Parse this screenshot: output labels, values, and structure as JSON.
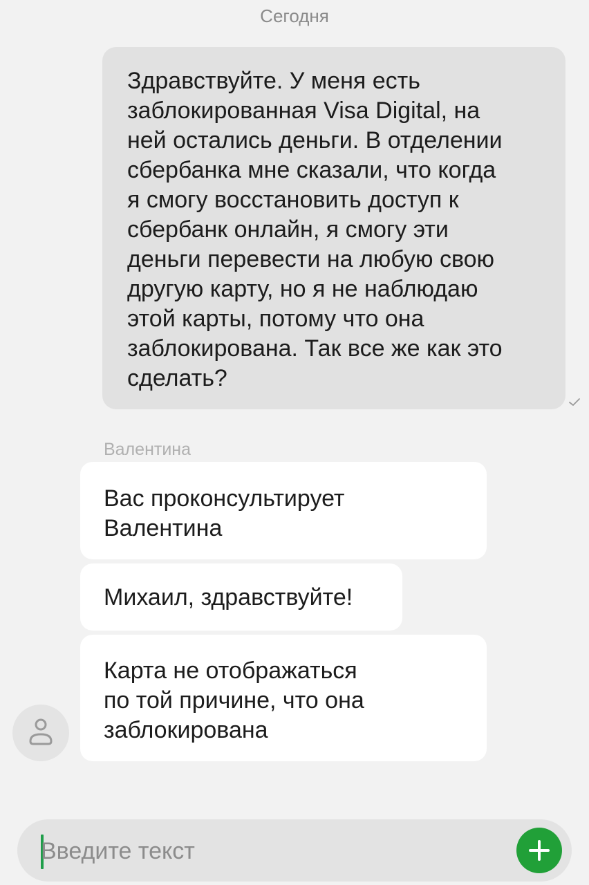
{
  "chat": {
    "date_separator": "Сегодня",
    "outgoing": {
      "lines": [
        "Здравствуйте. У меня есть",
        "заблокированная Visa Digital, на",
        "ней остались деньги. В отделении",
        "сбербанка мне сказали, что когда",
        "я смогу восстановить доступ к",
        "сбербанк онлайн, я смогу эти",
        "деньги перевести на любую свою",
        "другую карту, но я не наблюдаю",
        "этой карты, потому что она",
        "заблокирована. Так все же как это",
        "сделать?"
      ],
      "status_icon": "check-icon"
    },
    "operator_name": "Валентина",
    "incoming": [
      {
        "lines": [
          "Вас проконсультирует",
          "Валентина"
        ]
      },
      {
        "lines": [
          "Михаил, здравствуйте!"
        ]
      },
      {
        "lines": [
          "Карта не отображаться",
          "по той причине, что она",
          "заблокирована"
        ]
      }
    ],
    "avatar_icon": "person-icon"
  },
  "composer": {
    "placeholder": "Введите текст",
    "add_icon": "plus-icon",
    "accent_color": "#21a038"
  }
}
